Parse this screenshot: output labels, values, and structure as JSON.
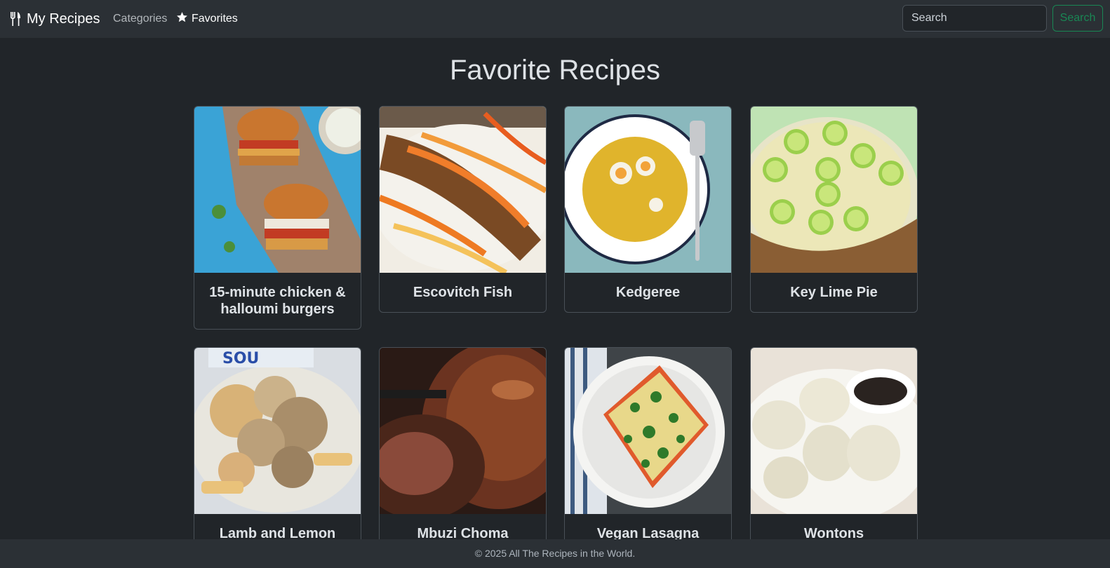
{
  "nav": {
    "brand": "My Recipes",
    "categories": "Categories",
    "favorites": "Favorites",
    "search_placeholder": "Search",
    "search_button": "Search"
  },
  "page": {
    "title": "Favorite Recipes"
  },
  "recipes": [
    {
      "title": "15-minute chicken & halloumi burgers"
    },
    {
      "title": "Escovitch Fish"
    },
    {
      "title": "Kedgeree"
    },
    {
      "title": "Key Lime Pie"
    },
    {
      "title": "Lamb and Lemon Souvlaki"
    },
    {
      "title": "Mbuzi Choma (Roasted Goat)"
    },
    {
      "title": "Vegan Lasagna"
    },
    {
      "title": "Wontons"
    }
  ],
  "footer": {
    "text": "© 2025 All The Recipes in the World."
  },
  "colors": {
    "background": "#212529",
    "navbar": "#2b3035",
    "success": "#198754"
  }
}
